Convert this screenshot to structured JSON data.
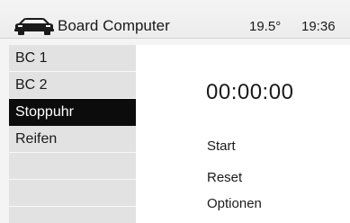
{
  "header": {
    "title": "Board Computer",
    "temperature": "19.5°",
    "time": "19:36",
    "icon": "car-icon"
  },
  "menu": {
    "items": [
      {
        "label": "BC 1",
        "selected": false
      },
      {
        "label": "BC 2",
        "selected": false
      },
      {
        "label": "Stoppuhr",
        "selected": true
      },
      {
        "label": "Reifen",
        "selected": false
      },
      {
        "label": "",
        "selected": false
      },
      {
        "label": "",
        "selected": false
      },
      {
        "label": "",
        "selected": false
      }
    ]
  },
  "stopwatch": {
    "display": "00:00:00",
    "actions": [
      "Start",
      "Reset",
      "Optionen"
    ]
  },
  "colors": {
    "background": "#f4f4f4",
    "menu_background": "#e2e2e2",
    "selected_background": "#0c0c0c",
    "selected_text": "#ffffff",
    "content_background": "#ffffff"
  }
}
